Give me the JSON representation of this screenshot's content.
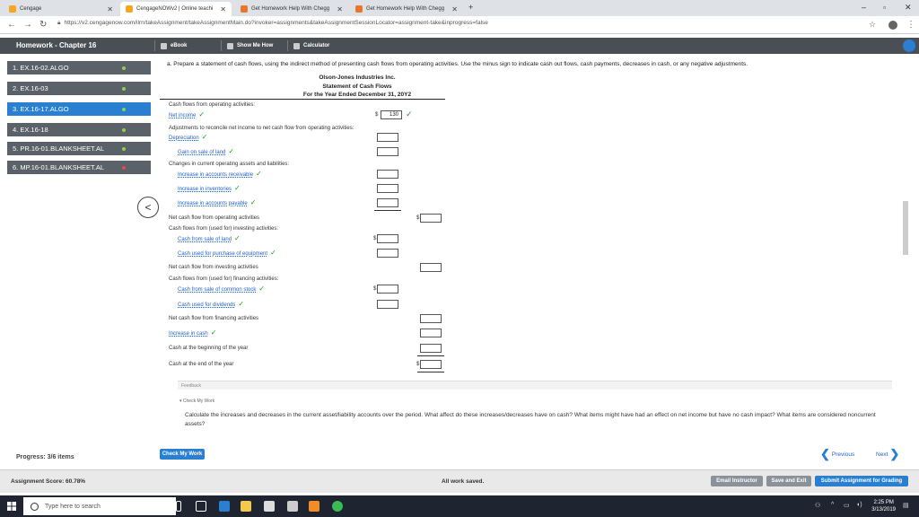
{
  "browser": {
    "tabs": [
      {
        "title": "Cengage",
        "active": false
      },
      {
        "title": "CengageNOWv2 | Online teachi",
        "active": true
      },
      {
        "title": "Get Homework Help With Chegg",
        "active": false
      },
      {
        "title": "Get Homework Help With Chegg",
        "active": false
      }
    ],
    "url": "https://v2.cengagenow.com/ilrn/takeAssignment/takeAssignmentMain.do?invoker=assignments&takeAssignmentSessionLocator=assignment-take&inprogress=false"
  },
  "app": {
    "title": "Homework - Chapter 16",
    "tools": [
      "eBook",
      "Show Me How",
      "Calculator"
    ]
  },
  "sidebar": {
    "items": [
      {
        "label": "1. EX.16-02.ALGO",
        "status": "complete"
      },
      {
        "label": "2. EX.16-03",
        "status": "complete"
      },
      {
        "label": "3. EX.16-17.ALGO",
        "status": "complete",
        "active": true
      },
      {
        "label": "4. EX.16-18",
        "status": "complete"
      },
      {
        "label": "5. PR.16-01.BLANKSHEET.AL",
        "status": "complete"
      },
      {
        "label": "6. MP.16-01.BLANKSHEET.AL",
        "status": "incomplete"
      }
    ],
    "progress": "Progress: 3/6 items"
  },
  "question": {
    "prompt": "a. Prepare a statement of cash flows, using the indirect method of presenting cash flows from operating activities. Use the minus sign to indicate cash out flows, cash payments, decreases in cash, or any negative adjustments.",
    "company": "Olson-Jones Industries Inc.",
    "statement": "Statement of Cash Flows",
    "period": "For the Year Ended December 31, 20Y2"
  },
  "statement_rows": {
    "operating_header": "Cash flows from operating activities:",
    "net_income": "Net income",
    "net_income_value": "130",
    "adjustments_header": "Adjustments to reconcile net income to net cash flow from operating activities:",
    "depreciation": "Depreciation",
    "gain_on_sale": "Gain on sale of land",
    "changes_header": "Changes in current operating assets and liabilities:",
    "increase_ar": "Increase in accounts receivable",
    "increase_inv": "Increase in inventories",
    "increase_ap": "Increase in accounts payable",
    "net_operating": "Net cash flow from operating activities",
    "investing_header": "Cash flows from (used for) investing activities:",
    "sale_of_land": "Cash from sale of land",
    "purchase_equipment": "Cash used for purchase of equipment",
    "net_investing": "Net cash flow from investing activities",
    "financing_header": "Cash flows from (used for) financing activities:",
    "sale_of_stock": "Cash from sale of common stock",
    "dividends": "Cash used for dividends",
    "net_financing": "Net cash flow from financing activities",
    "increase_cash": "Increase in cash",
    "cash_beginning": "Cash at the beginning of the year",
    "cash_end": "Cash at the end of the year",
    "dollar": "$",
    "check": "✓"
  },
  "feedback": {
    "label": "Feedback",
    "check_label": "▾ Check My Work",
    "hint": "Calculate the increases and decreases in the current asset/liability accounts over the period. What affect do these increases/decreases have on cash? What items might have had an effect on net income but have no cash impact? What items are considered noncurrent assets?"
  },
  "buttons": {
    "check_my_work": "Check My Work",
    "previous": "Previous",
    "next": "Next",
    "email": "Email Instructor",
    "save_exit": "Save and Exit",
    "submit": "Submit Assignment for Grading"
  },
  "footer": {
    "score": "Assignment Score: 60.78%",
    "saved": "All work saved."
  },
  "taskbar": {
    "search_placeholder": "Type here to search",
    "time": "2:25 PM",
    "date": "3/13/2019"
  }
}
